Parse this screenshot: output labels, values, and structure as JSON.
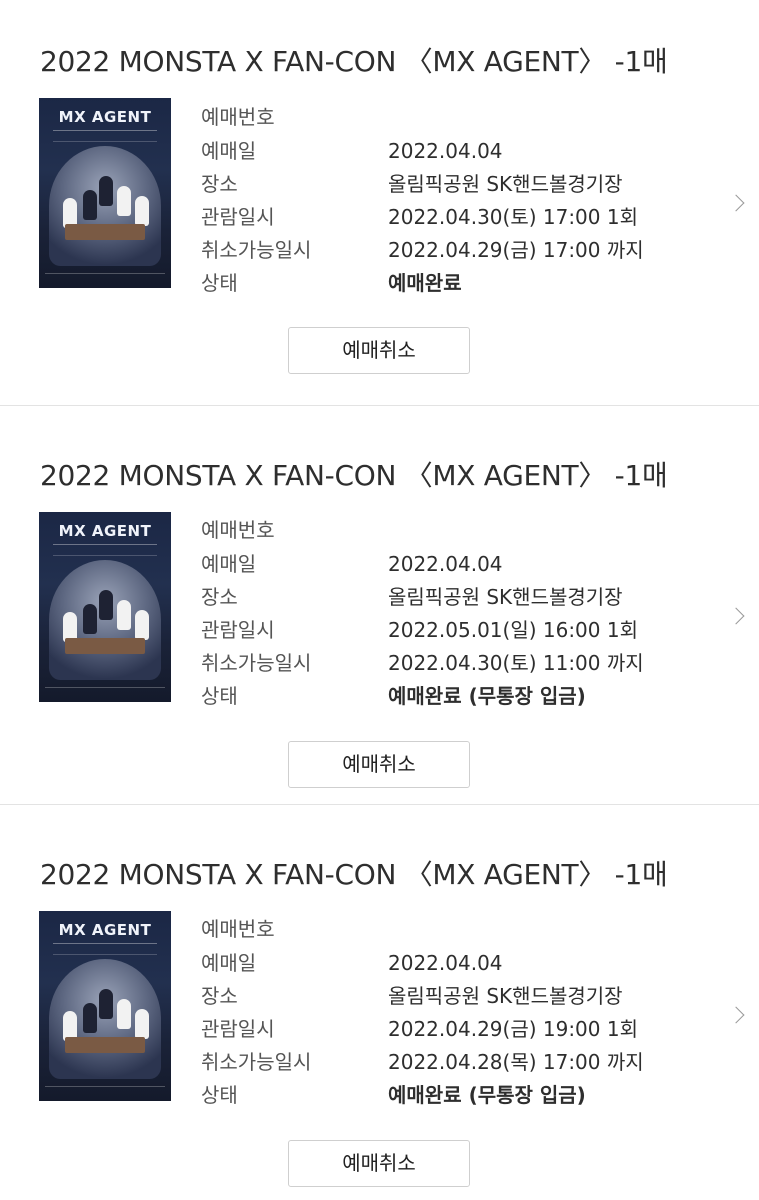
{
  "bookings": [
    {
      "title": "2022 MONSTA X FAN-CON 〈MX AGENT〉 -1매",
      "poster_text": "MX AGENT",
      "labels": {
        "number": "예매번호",
        "date": "예매일",
        "venue": "장소",
        "show_time": "관람일시",
        "cancel_deadline": "취소가능일시",
        "status": "상태"
      },
      "number": "",
      "date": "2022.04.04",
      "venue": "올림픽공원 SK핸드볼경기장",
      "show_time": "2022.04.30(토) 17:00 1회",
      "cancel_deadline": "2022.04.29(금) 17:00 까지",
      "status": "예매완료",
      "cancel_label": "예매취소"
    },
    {
      "title": "2022 MONSTA X FAN-CON 〈MX AGENT〉 -1매",
      "poster_text": "MX AGENT",
      "labels": {
        "number": "예매번호",
        "date": "예매일",
        "venue": "장소",
        "show_time": "관람일시",
        "cancel_deadline": "취소가능일시",
        "status": "상태"
      },
      "number": "",
      "date": "2022.04.04",
      "venue": "올림픽공원 SK핸드볼경기장",
      "show_time": "2022.05.01(일) 16:00 1회",
      "cancel_deadline": "2022.04.30(토) 11:00 까지",
      "status": "예매완료 (무통장 입금)",
      "cancel_label": "예매취소"
    },
    {
      "title": "2022 MONSTA X FAN-CON 〈MX AGENT〉 -1매",
      "poster_text": "MX AGENT",
      "labels": {
        "number": "예매번호",
        "date": "예매일",
        "venue": "장소",
        "show_time": "관람일시",
        "cancel_deadline": "취소가능일시",
        "status": "상태"
      },
      "number": "",
      "date": "2022.04.04",
      "venue": "올림픽공원 SK핸드볼경기장",
      "show_time": "2022.04.29(금) 19:00 1회",
      "cancel_deadline": "2022.04.28(목) 17:00 까지",
      "status": "예매완료 (무통장 입금)",
      "cancel_label": "예매취소"
    }
  ]
}
